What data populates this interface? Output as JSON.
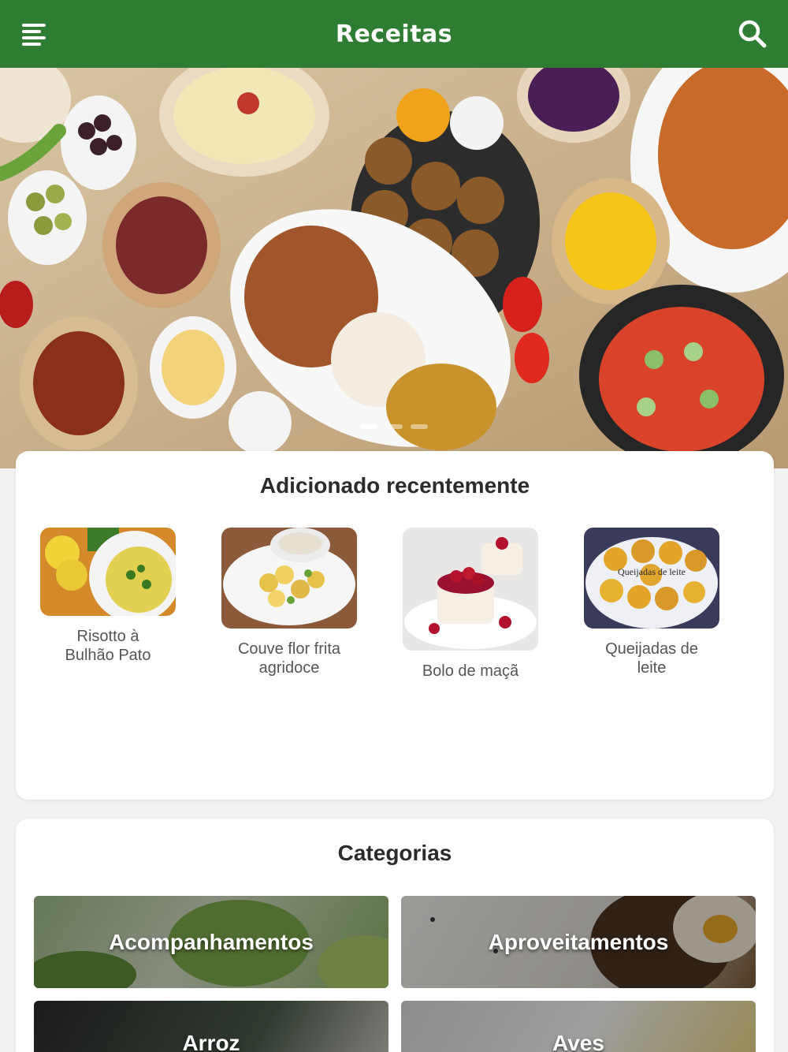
{
  "app_bar": {
    "title": "Receitas",
    "menu_icon": "menu-icon",
    "search_icon": "search-icon",
    "color": "#2e7d32"
  },
  "hero": {
    "slides": 3,
    "active_slide": 1
  },
  "recent": {
    "title": "Adicionado recentemente",
    "items": [
      {
        "label": "Risotto à\nBulhão Pato"
      },
      {
        "label": "Couve flor frita\nagridoce"
      },
      {
        "label": "Bolo de maçã"
      },
      {
        "label": "Queijadas de\nleite",
        "image_text": "Queijadas de leite"
      }
    ]
  },
  "categories": {
    "title": "Categorias",
    "items": [
      {
        "label": "Acompanhamentos"
      },
      {
        "label": "Aproveitamentos"
      },
      {
        "label": "Arroz"
      },
      {
        "label": "Aves"
      }
    ]
  }
}
